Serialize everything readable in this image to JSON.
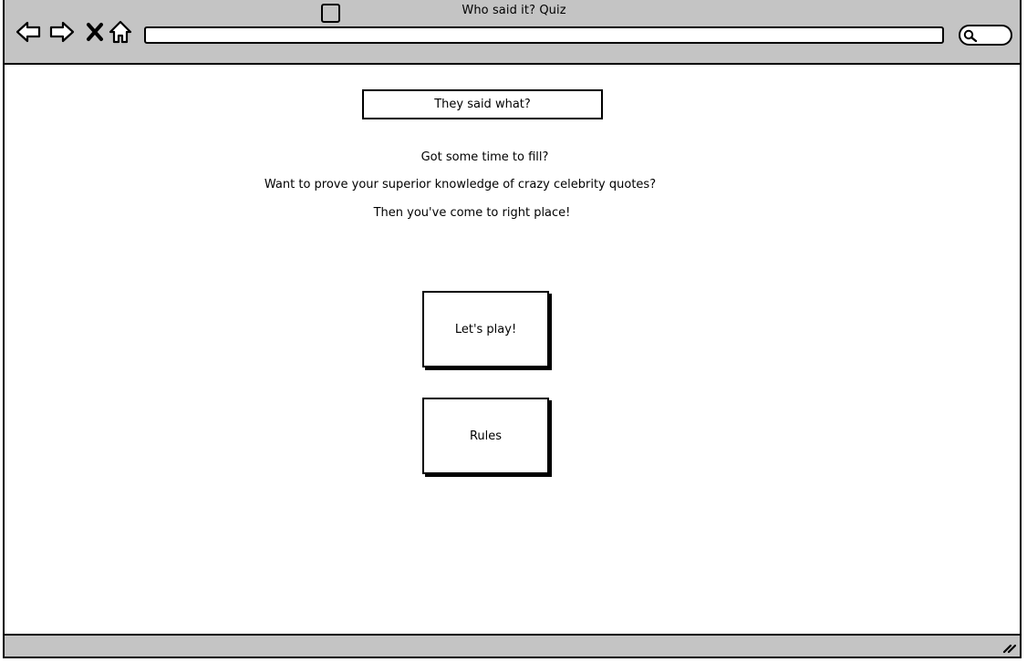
{
  "window": {
    "title": "Who said it?  Quiz"
  },
  "toolbar": {
    "address_value": ""
  },
  "main": {
    "page_title": "They said what?",
    "intro_lines": [
      "Got some time to fill?",
      "Want to prove your superior knowledge of crazy celebrity quotes?",
      "Then you've come to right place!"
    ],
    "play_button_label": "Let's play!",
    "rules_button_label": "Rules"
  },
  "colors": {
    "chrome_gray": "#c4c4c4",
    "stroke": "#000000",
    "background": "#ffffff"
  }
}
